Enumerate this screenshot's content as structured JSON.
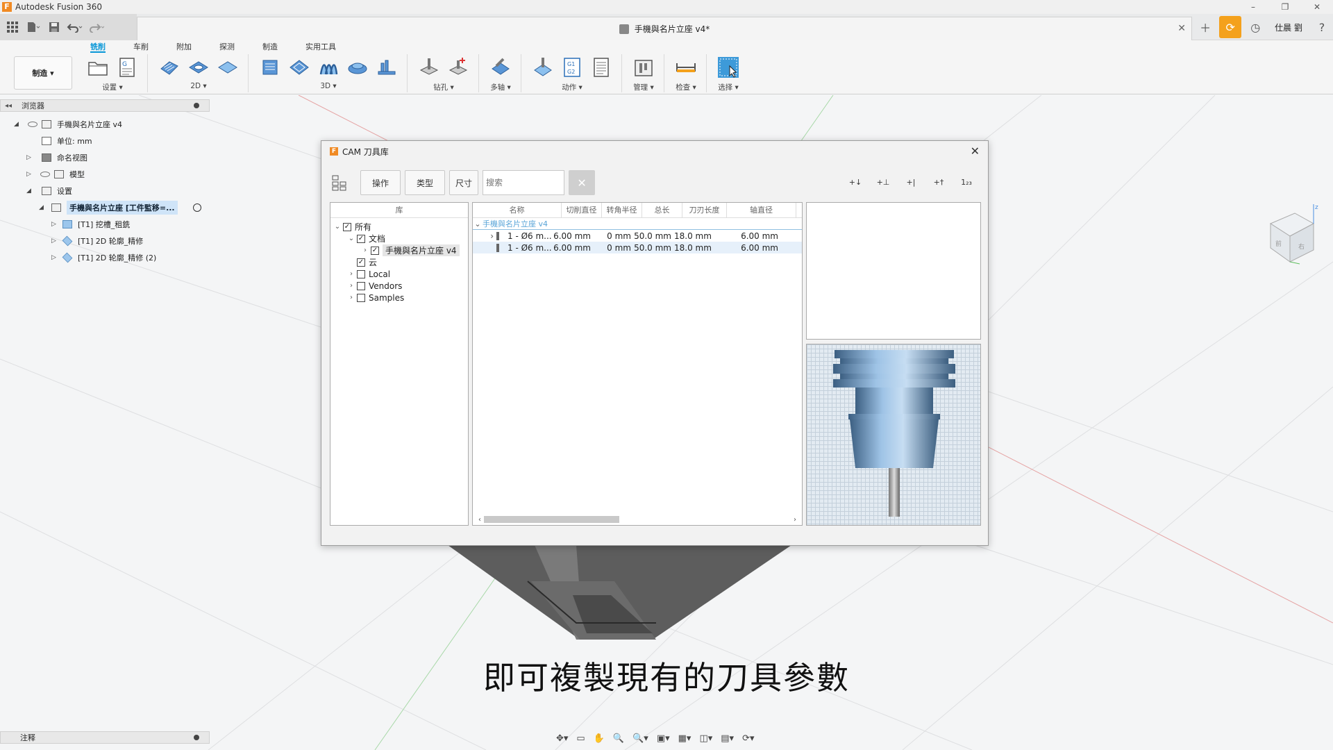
{
  "app": {
    "title": "Autodesk Fusion 360",
    "logo_letter": "F"
  },
  "window_controls": {
    "minimize": "–",
    "restore": "❐",
    "close": "✕"
  },
  "document": {
    "title": "手機與名片立座 v4*",
    "close": "✕"
  },
  "user": {
    "name": "仕晨 劉"
  },
  "ribbon": {
    "workspace": "制造 ▾",
    "tabs": [
      "铣削",
      "车削",
      "附加",
      "探测",
      "制造",
      "实用工具"
    ],
    "active_tab": "铣削",
    "groups": [
      {
        "label": "设置 ▾"
      },
      {
        "label": "2D ▾"
      },
      {
        "label": "3D ▾"
      },
      {
        "label": "钻孔 ▾"
      },
      {
        "label": "多轴 ▾"
      },
      {
        "label": "动作 ▾"
      },
      {
        "label": "管理 ▾"
      },
      {
        "label": "检查 ▾"
      },
      {
        "label": "选择 ▾"
      }
    ]
  },
  "browser": {
    "title": "浏览器",
    "items": [
      {
        "label": "手機與名片立座 v4"
      },
      {
        "label": "单位: mm"
      },
      {
        "label": "命名视图"
      },
      {
        "label": "模型"
      },
      {
        "label": "设置"
      },
      {
        "label": "手機與名片立座 [工件監移=..."
      },
      {
        "label": "[T1] 挖槽_租銑"
      },
      {
        "label": "[T1] 2D 轮廓_精修"
      },
      {
        "label": "[T1] 2D 轮廓_精修 (2)"
      }
    ]
  },
  "comments": {
    "title": "注释"
  },
  "caption": "即可複製現有的刀具參數",
  "dialog": {
    "title": "CAM 刀具库",
    "close": "✕",
    "toolbar": {
      "operation": "操作",
      "type": "类型",
      "size": "尺寸",
      "search_placeholder": "搜索",
      "clear": "✕"
    },
    "library": {
      "header": "库",
      "items": [
        {
          "label": "所有",
          "checked": true
        },
        {
          "label": "文档",
          "checked": true
        },
        {
          "label": "手機與名片立座 v4",
          "checked": true
        },
        {
          "label": "云",
          "checked": true
        },
        {
          "label": "Local",
          "checked": false
        },
        {
          "label": "Vendors",
          "checked": false
        },
        {
          "label": "Samples",
          "checked": false
        }
      ]
    },
    "tools": {
      "columns": [
        "名称",
        "切削直径",
        "转角半径",
        "总长",
        "刀刃长度",
        "轴直径"
      ],
      "group": "手機與名片立座 v4",
      "rows": [
        [
          "1 - Ø6 m...",
          "6.00 mm",
          "0 mm",
          "50.0 mm",
          "18.0 mm",
          "6.00 mm"
        ],
        [
          "1 - Ø6 m...",
          "6.00 mm",
          "0 mm",
          "50.0 mm",
          "18.0 mm",
          "6.00 mm"
        ]
      ]
    },
    "right_icons": [
      "+↓",
      "+⊥",
      "+|",
      "+†",
      "1₂₃"
    ]
  },
  "nav_bar": [
    "✥▾",
    "▭",
    "✋",
    "🔍",
    "🔍▾",
    "▣▾",
    "▦▾",
    "◫▾",
    "▤▾",
    "⟳▾"
  ]
}
